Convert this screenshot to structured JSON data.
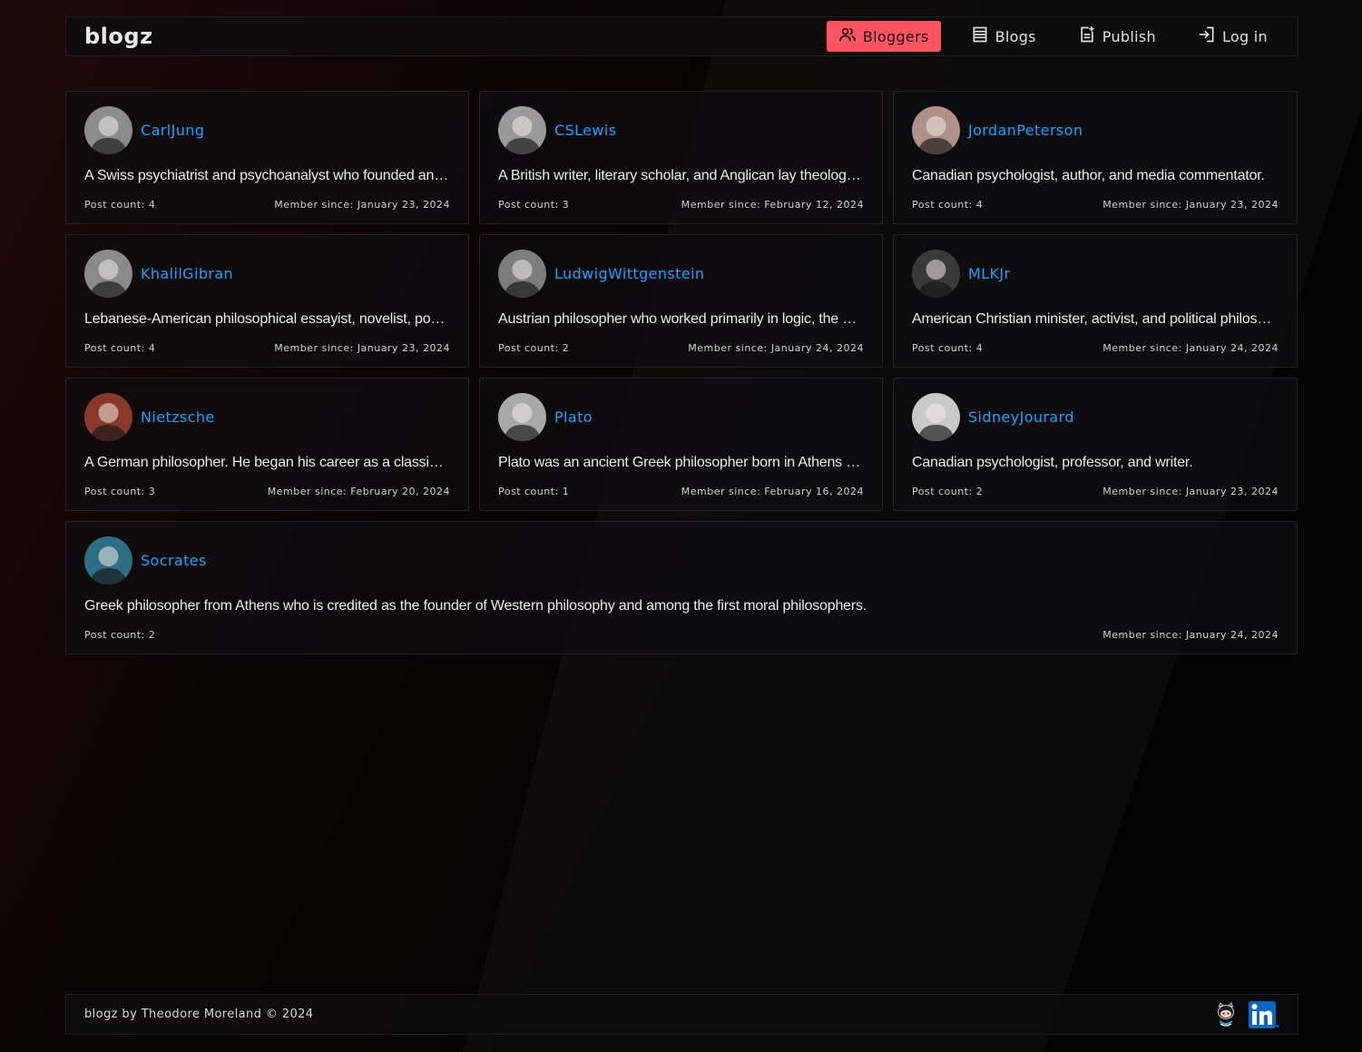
{
  "app": {
    "brand": "blogz"
  },
  "nav": [
    {
      "label": "Bloggers",
      "icon": "users-icon",
      "active": true
    },
    {
      "label": "Blogs",
      "icon": "book-icon",
      "active": false
    },
    {
      "label": "Publish",
      "icon": "document-add-icon",
      "active": false
    },
    {
      "label": "Log in",
      "icon": "login-icon",
      "active": false
    }
  ],
  "bloggers": [
    {
      "name": "CarlJung",
      "bio": "A Swiss psychiatrist and psychoanalyst who founded analytical psychology.",
      "post_count": "Post count: 4",
      "member_since": "Member since: January 23, 2024",
      "avatar_tone": "#8c8c8c"
    },
    {
      "name": "CSLewis",
      "bio": "A British writer, literary scholar, and Anglican lay theologian.",
      "post_count": "Post count: 3",
      "member_since": "Member since: February 12, 2024",
      "avatar_tone": "#9a9a9a"
    },
    {
      "name": "JordanPeterson",
      "bio": "Canadian psychologist, author, and media commentator.",
      "post_count": "Post count: 4",
      "member_since": "Member since: January 23, 2024",
      "avatar_tone": "#b0908a"
    },
    {
      "name": "KhalilGibran",
      "bio": "Lebanese-American philosophical essayist, novelist, poet, and visual artist.",
      "post_count": "Post count: 4",
      "member_since": "Member since: January 23, 2024",
      "avatar_tone": "#8a8a8a"
    },
    {
      "name": "LudwigWittgenstein",
      "bio": "Austrian philosopher who worked primarily in logic, the philosophy of mathematics, the philosophy of mind, and the philosophy of language.",
      "post_count": "Post count: 2",
      "member_since": "Member since: January 24, 2024",
      "avatar_tone": "#7d7d7d"
    },
    {
      "name": "MLKJr",
      "bio": "American Christian minister, activist, and political philosopher.",
      "post_count": "Post count: 4",
      "member_since": "Member since: January 24, 2024",
      "avatar_tone": "#3a3a3a"
    },
    {
      "name": "Nietzsche",
      "bio": "A German philosopher. He began his career as a classical philologist.",
      "post_count": "Post count: 3",
      "member_since": "Member since: February 20, 2024",
      "avatar_tone": "#8a3a2a"
    },
    {
      "name": "Plato",
      "bio": "Plato was an ancient Greek philosopher born in Athens during the Classical period.",
      "post_count": "Post count: 1",
      "member_since": "Member since: February 16, 2024",
      "avatar_tone": "#a8a8a8"
    },
    {
      "name": "SidneyJourard",
      "bio": "Canadian psychologist, professor, and writer.",
      "post_count": "Post count: 2",
      "member_since": "Member since: January 23, 2024",
      "avatar_tone": "#c8c8c8"
    },
    {
      "name": "Socrates",
      "bio": "Greek philosopher from Athens who is credited as the founder of Western philosophy and among the first moral philosophers.",
      "post_count": "Post count: 2",
      "member_since": "Member since: January 24, 2024",
      "avatar_tone": "#2e6f86"
    }
  ],
  "footer": {
    "text": "blogz by Theodore Moreland © 2024",
    "icons": [
      "github-icon",
      "linkedin-icon"
    ]
  },
  "colors": {
    "accent": "#ff5561",
    "link": "#1aa3ff",
    "linkedin": "#0a66c2"
  }
}
